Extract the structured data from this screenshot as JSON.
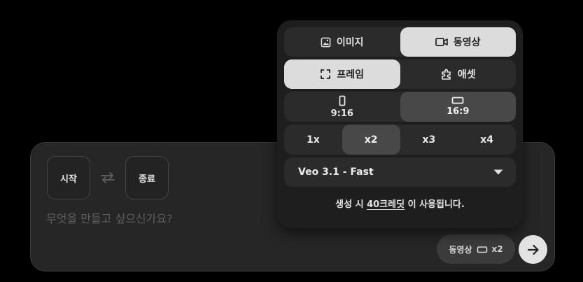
{
  "popover": {
    "mode_tabs": [
      {
        "label": "이미지",
        "icon": "image-icon",
        "active": false
      },
      {
        "label": "동영상",
        "icon": "video-camera-icon",
        "active": true
      }
    ],
    "frame_tabs": [
      {
        "label": "프레임",
        "icon": "frame-corners-icon",
        "active": true
      },
      {
        "label": "애셋",
        "icon": "asset-icon",
        "active": false
      }
    ],
    "aspect_options": [
      {
        "label": "9:16",
        "icon": "portrait-ratio-icon",
        "active": false
      },
      {
        "label": "16:9",
        "icon": "landscape-ratio-icon",
        "active": true
      }
    ],
    "count_options": [
      {
        "label": "1x",
        "active": false
      },
      {
        "label": "x2",
        "active": true
      },
      {
        "label": "x3",
        "active": false
      },
      {
        "label": "x4",
        "active": false
      }
    ],
    "model": {
      "selected": "Veo 3.1 - Fast",
      "icon": "caret-down-icon"
    },
    "credit_note": {
      "prefix": "생성 시 ",
      "link": "40크레딧",
      "suffix": " 이 사용됩니다."
    }
  },
  "composer": {
    "start_label": "시작",
    "end_label": "종료",
    "swap_icon": "swap-arrows-icon",
    "prompt_placeholder": "무엇을 만들고 싶으신가요?",
    "prompt_value": "",
    "summary_chip": {
      "mode": "동영상",
      "icon": "landscape-ratio-icon",
      "count": "x2"
    },
    "send_icon": "arrow-right-icon"
  },
  "colors": {
    "background": "#000000",
    "surface": "#262626",
    "popover": "#1e1e1e",
    "segment": "#2b2b2b",
    "active_light": "#dcdcdc",
    "active_dark": "#484848",
    "placeholder": "#5e5e5e"
  }
}
